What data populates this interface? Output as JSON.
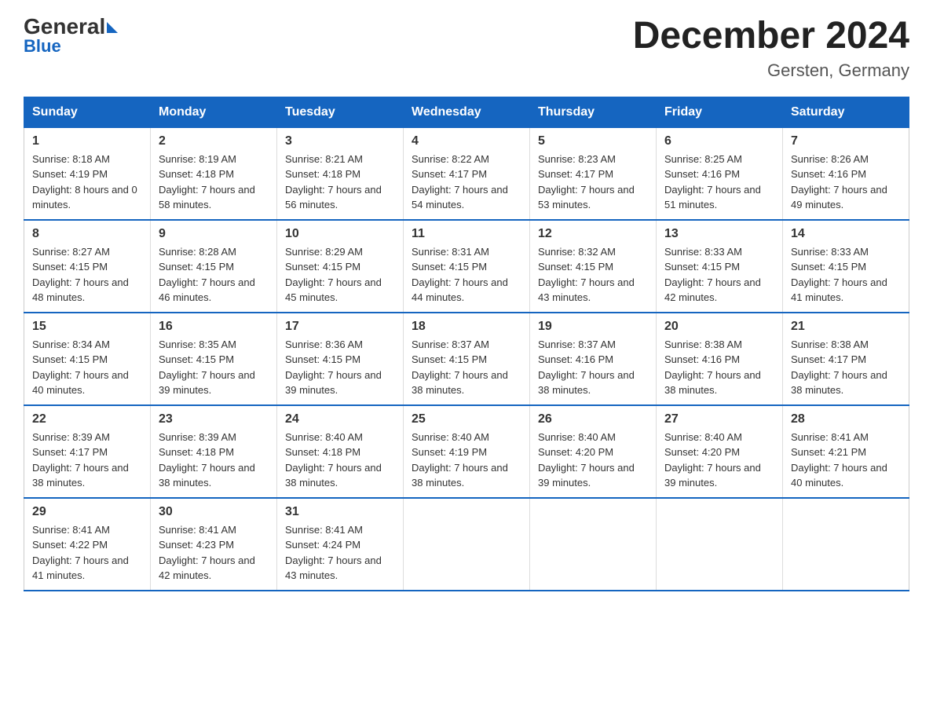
{
  "logo": {
    "general": "General",
    "arrow": "▶",
    "blue": "Blue"
  },
  "title": "December 2024",
  "location": "Gersten, Germany",
  "days_header": [
    "Sunday",
    "Monday",
    "Tuesday",
    "Wednesday",
    "Thursday",
    "Friday",
    "Saturday"
  ],
  "weeks": [
    [
      {
        "day": "1",
        "sunrise": "8:18 AM",
        "sunset": "4:19 PM",
        "daylight": "8 hours and 0 minutes."
      },
      {
        "day": "2",
        "sunrise": "8:19 AM",
        "sunset": "4:18 PM",
        "daylight": "7 hours and 58 minutes."
      },
      {
        "day": "3",
        "sunrise": "8:21 AM",
        "sunset": "4:18 PM",
        "daylight": "7 hours and 56 minutes."
      },
      {
        "day": "4",
        "sunrise": "8:22 AM",
        "sunset": "4:17 PM",
        "daylight": "7 hours and 54 minutes."
      },
      {
        "day": "5",
        "sunrise": "8:23 AM",
        "sunset": "4:17 PM",
        "daylight": "7 hours and 53 minutes."
      },
      {
        "day": "6",
        "sunrise": "8:25 AM",
        "sunset": "4:16 PM",
        "daylight": "7 hours and 51 minutes."
      },
      {
        "day": "7",
        "sunrise": "8:26 AM",
        "sunset": "4:16 PM",
        "daylight": "7 hours and 49 minutes."
      }
    ],
    [
      {
        "day": "8",
        "sunrise": "8:27 AM",
        "sunset": "4:15 PM",
        "daylight": "7 hours and 48 minutes."
      },
      {
        "day": "9",
        "sunrise": "8:28 AM",
        "sunset": "4:15 PM",
        "daylight": "7 hours and 46 minutes."
      },
      {
        "day": "10",
        "sunrise": "8:29 AM",
        "sunset": "4:15 PM",
        "daylight": "7 hours and 45 minutes."
      },
      {
        "day": "11",
        "sunrise": "8:31 AM",
        "sunset": "4:15 PM",
        "daylight": "7 hours and 44 minutes."
      },
      {
        "day": "12",
        "sunrise": "8:32 AM",
        "sunset": "4:15 PM",
        "daylight": "7 hours and 43 minutes."
      },
      {
        "day": "13",
        "sunrise": "8:33 AM",
        "sunset": "4:15 PM",
        "daylight": "7 hours and 42 minutes."
      },
      {
        "day": "14",
        "sunrise": "8:33 AM",
        "sunset": "4:15 PM",
        "daylight": "7 hours and 41 minutes."
      }
    ],
    [
      {
        "day": "15",
        "sunrise": "8:34 AM",
        "sunset": "4:15 PM",
        "daylight": "7 hours and 40 minutes."
      },
      {
        "day": "16",
        "sunrise": "8:35 AM",
        "sunset": "4:15 PM",
        "daylight": "7 hours and 39 minutes."
      },
      {
        "day": "17",
        "sunrise": "8:36 AM",
        "sunset": "4:15 PM",
        "daylight": "7 hours and 39 minutes."
      },
      {
        "day": "18",
        "sunrise": "8:37 AM",
        "sunset": "4:15 PM",
        "daylight": "7 hours and 38 minutes."
      },
      {
        "day": "19",
        "sunrise": "8:37 AM",
        "sunset": "4:16 PM",
        "daylight": "7 hours and 38 minutes."
      },
      {
        "day": "20",
        "sunrise": "8:38 AM",
        "sunset": "4:16 PM",
        "daylight": "7 hours and 38 minutes."
      },
      {
        "day": "21",
        "sunrise": "8:38 AM",
        "sunset": "4:17 PM",
        "daylight": "7 hours and 38 minutes."
      }
    ],
    [
      {
        "day": "22",
        "sunrise": "8:39 AM",
        "sunset": "4:17 PM",
        "daylight": "7 hours and 38 minutes."
      },
      {
        "day": "23",
        "sunrise": "8:39 AM",
        "sunset": "4:18 PM",
        "daylight": "7 hours and 38 minutes."
      },
      {
        "day": "24",
        "sunrise": "8:40 AM",
        "sunset": "4:18 PM",
        "daylight": "7 hours and 38 minutes."
      },
      {
        "day": "25",
        "sunrise": "8:40 AM",
        "sunset": "4:19 PM",
        "daylight": "7 hours and 38 minutes."
      },
      {
        "day": "26",
        "sunrise": "8:40 AM",
        "sunset": "4:20 PM",
        "daylight": "7 hours and 39 minutes."
      },
      {
        "day": "27",
        "sunrise": "8:40 AM",
        "sunset": "4:20 PM",
        "daylight": "7 hours and 39 minutes."
      },
      {
        "day": "28",
        "sunrise": "8:41 AM",
        "sunset": "4:21 PM",
        "daylight": "7 hours and 40 minutes."
      }
    ],
    [
      {
        "day": "29",
        "sunrise": "8:41 AM",
        "sunset": "4:22 PM",
        "daylight": "7 hours and 41 minutes."
      },
      {
        "day": "30",
        "sunrise": "8:41 AM",
        "sunset": "4:23 PM",
        "daylight": "7 hours and 42 minutes."
      },
      {
        "day": "31",
        "sunrise": "8:41 AM",
        "sunset": "4:24 PM",
        "daylight": "7 hours and 43 minutes."
      },
      null,
      null,
      null,
      null
    ]
  ]
}
